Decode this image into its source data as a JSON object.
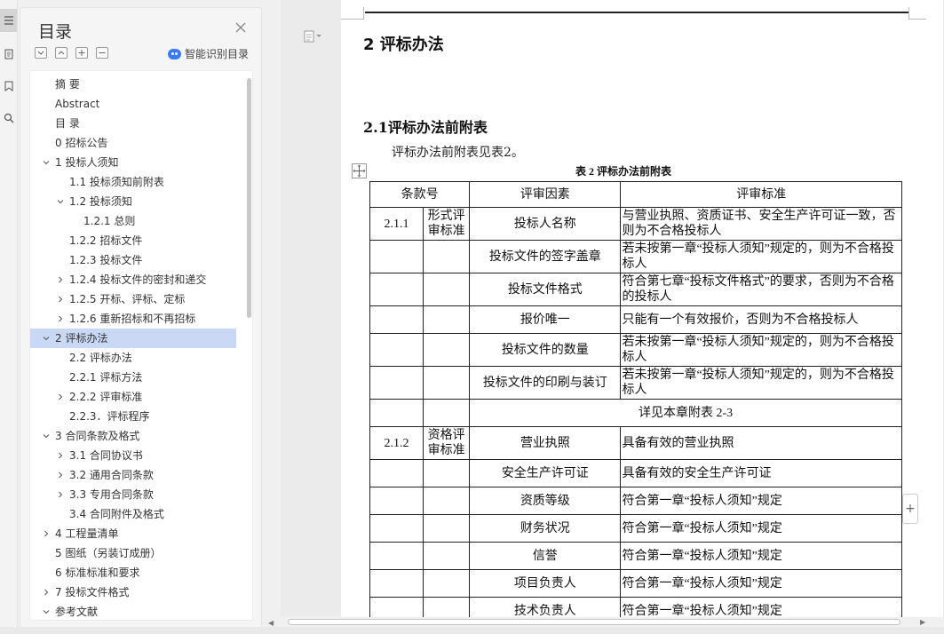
{
  "panel": {
    "title": "目录",
    "smart_label": "智能识别目录",
    "tree": [
      {
        "label": "摘   要"
      },
      {
        "label": "Abstract"
      },
      {
        "label": "目   录"
      },
      {
        "label": "0  招标公告"
      },
      {
        "label": "1  投标人须知"
      },
      {
        "label": "1.1 投标须知前附表"
      },
      {
        "label": "1.2 投标须知"
      },
      {
        "label": "1.2.1 总则"
      },
      {
        "label": "1.2.2 招标文件"
      },
      {
        "label": "1.2.3 投标文件"
      },
      {
        "label": "1.2.4 投标文件的密封和递交"
      },
      {
        "label": "1.2.5 开标、评标、定标"
      },
      {
        "label": "1.2.6 重新招标和不再招标"
      },
      {
        "label": "2 评标办法"
      },
      {
        "label": "2.2 评标办法"
      },
      {
        "label": "2.2.1 评标方法"
      },
      {
        "label": "2.2.2 评审标准"
      },
      {
        "label": "2.2.3．评标程序"
      },
      {
        "label": "3 合同条款及格式"
      },
      {
        "label": "3.1  合同协议书"
      },
      {
        "label": "3.2  通用合同条款"
      },
      {
        "label": "3.3  专用合同条款"
      },
      {
        "label": "3.4  合同附件及格式"
      },
      {
        "label": "4 工程量清单"
      },
      {
        "label": "5 图纸（另装订成册）"
      },
      {
        "label": "6  标准标准和要求"
      },
      {
        "label": "7 投标文件格式"
      },
      {
        "label": "参考文献"
      }
    ]
  },
  "doc": {
    "h2": "2 评标办法",
    "h3": "2.1评标办法前附表",
    "para": "评标办法前附表见表2。",
    "caption": "表 2    评标办法前附表",
    "table": {
      "headers": [
        "条款号",
        "评审因素",
        "评审标准"
      ],
      "r1": {
        "c1": "2.1.1",
        "c2": "形式评审标准",
        "c3": "投标人名称",
        "c4": "与营业执照、资质证书、安全生产许可证一致，否则为不合格投标人"
      },
      "r2": {
        "c3": "投标文件的签字盖章",
        "c4": "若未按第一章“投标人须知”规定的，则为不合格投标人"
      },
      "r3": {
        "c3": "投标文件格式",
        "c4": "符合第七章“投标文件格式”的要求，否则为不合格的投标人"
      },
      "r4": {
        "c3": "报价唯一",
        "c4": "只能有一个有效报价，否则为不合格投标人"
      },
      "r5": {
        "c3": "投标文件的数量",
        "c4": "若未按第一章“投标人须知”规定的，则为不合格投标人"
      },
      "r6": {
        "c3": "投标文件的印刷与装订",
        "c4": "若未按第一章“投标人须知”规定的，则为不合格投标人"
      },
      "r7": {
        "c34": "详见本章附表 2-3"
      },
      "r8": {
        "c1": "2.1.2",
        "c2": "资格评审标准",
        "c3": "营业执照",
        "c4": "具备有效的营业执照"
      },
      "r9": {
        "c3": "安全生产许可证",
        "c4": "具备有效的安全生产许可证"
      },
      "r10": {
        "c3": "资质等级",
        "c4": "符合第一章“投标人须知”规定"
      },
      "r11": {
        "c3": "财务状况",
        "c4": "符合第一章“投标人须知”规定"
      },
      "r12": {
        "c3": "信誉",
        "c4": "符合第一章“投标人须知”规定"
      },
      "r13": {
        "c3": "项目负责人",
        "c4": "符合第一章“投标人须知”规定"
      },
      "r14": {
        "c3": "技术负责人",
        "c4": "符合第一章“投标人须知”规定"
      }
    }
  },
  "colors": {
    "selected": "#c9d9f5",
    "accent": "#3b7cf4"
  }
}
